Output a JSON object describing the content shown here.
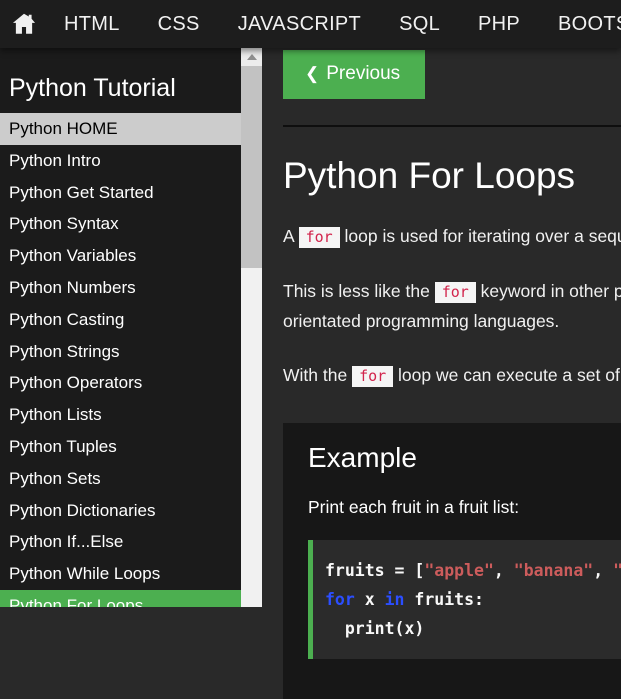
{
  "colors": {
    "accent_green": "#4CAF50",
    "navbar_bg": "#1d1d1d",
    "sidebar_bg": "#1b1b1b",
    "main_bg": "#292929",
    "example_panel_bg": "#171717",
    "code_bg": "#2b2b2b",
    "codespan_text": "#d2244c",
    "codespan_bg": "#f5f5f5",
    "code_string": "#cd5c5c",
    "code_keyword": "#2b4eff",
    "selected_item_bg": "#cccccc"
  },
  "navbar": {
    "home_icon": "home-icon",
    "items": [
      "HTML",
      "CSS",
      "JAVASCRIPT",
      "SQL",
      "PHP",
      "BOOTSTRAP"
    ]
  },
  "sidebar": {
    "title": "Python Tutorial",
    "items": [
      {
        "label": "Python HOME",
        "state": "active-home"
      },
      {
        "label": "Python Intro",
        "state": "normal"
      },
      {
        "label": "Python Get Started",
        "state": "normal"
      },
      {
        "label": "Python Syntax",
        "state": "normal"
      },
      {
        "label": "Python Variables",
        "state": "normal"
      },
      {
        "label": "Python Numbers",
        "state": "normal"
      },
      {
        "label": "Python Casting",
        "state": "normal"
      },
      {
        "label": "Python Strings",
        "state": "normal"
      },
      {
        "label": "Python Operators",
        "state": "normal"
      },
      {
        "label": "Python Lists",
        "state": "normal"
      },
      {
        "label": "Python Tuples",
        "state": "normal"
      },
      {
        "label": "Python Sets",
        "state": "normal"
      },
      {
        "label": "Python Dictionaries",
        "state": "normal"
      },
      {
        "label": "Python If...Else",
        "state": "normal"
      },
      {
        "label": "Python While Loops",
        "state": "normal"
      },
      {
        "label": "Python For Loops",
        "state": "active-green"
      }
    ]
  },
  "main": {
    "previous_button": {
      "icon": "❮",
      "label": "Previous"
    },
    "title": "Python For Loops",
    "paragraphs": [
      {
        "lines": [
          [
            {
              "t": "text",
              "v": "A "
            },
            {
              "t": "code",
              "v": "for"
            },
            {
              "t": "text",
              "v": " loop is used for iterating over a sequence (that is either a list, a tuple, a dictionary, a set, or a string)."
            }
          ]
        ]
      },
      {
        "lines": [
          [
            {
              "t": "text",
              "v": "This is less like the "
            },
            {
              "t": "code",
              "v": "for"
            },
            {
              "t": "text",
              "v": " keyword in other programming languages, and works more like an iterator method as found in other object-"
            }
          ],
          [
            {
              "t": "text",
              "v": "orientated programming languages."
            }
          ]
        ]
      },
      {
        "lines": [
          [
            {
              "t": "text",
              "v": "With the "
            },
            {
              "t": "code",
              "v": "for"
            },
            {
              "t": "text",
              "v": " loop we can execute a set of statements, once for each item in a list, tuple, set etc."
            }
          ]
        ]
      }
    ],
    "example": {
      "title": "Example",
      "description": "Print each fruit in a fruit list:",
      "code_lines": [
        [
          {
            "c": "plain",
            "v": "fruits = ["
          },
          {
            "c": "string",
            "v": "\"apple\""
          },
          {
            "c": "plain",
            "v": ", "
          },
          {
            "c": "string",
            "v": "\"banana\""
          },
          {
            "c": "plain",
            "v": ", "
          },
          {
            "c": "string",
            "v": "\"cherry\""
          },
          {
            "c": "plain",
            "v": "]"
          }
        ],
        [
          {
            "c": "keyword",
            "v": "for"
          },
          {
            "c": "plain",
            "v": " x "
          },
          {
            "c": "keyword",
            "v": "in"
          },
          {
            "c": "plain",
            "v": " fruits:"
          }
        ],
        [
          {
            "c": "plain",
            "v": "  print(x)"
          }
        ]
      ]
    }
  }
}
